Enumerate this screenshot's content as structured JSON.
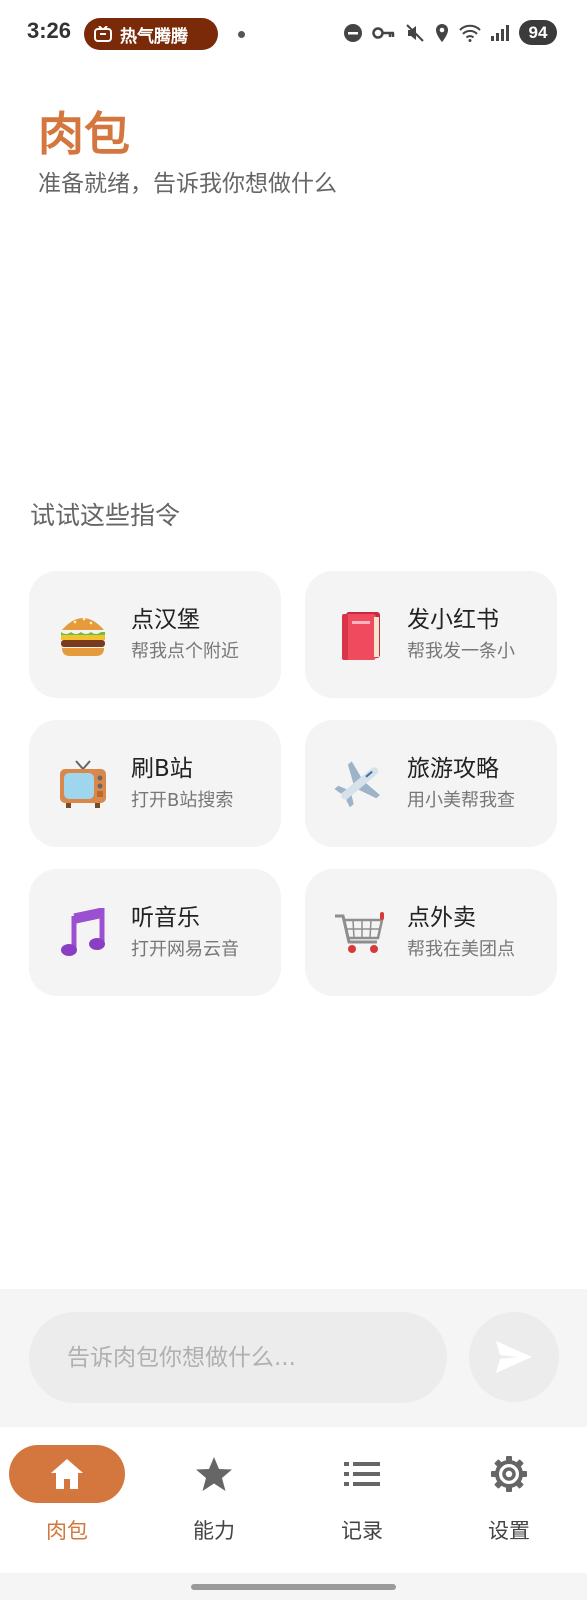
{
  "status_bar": {
    "time": "3:26",
    "notification": "热气腾腾",
    "battery": "94"
  },
  "header": {
    "title": "肉包",
    "subtitle": "准备就绪，告诉我你想做什么"
  },
  "suggestions": {
    "section_title": "试试这些指令",
    "items": [
      {
        "icon": "hamburger-icon",
        "title": "点汉堡",
        "desc": "帮我点个附近"
      },
      {
        "icon": "red-book-icon",
        "title": "发小红书",
        "desc": "帮我发一条小"
      },
      {
        "icon": "tv-icon",
        "title": "刷B站",
        "desc": "打开B站搜索"
      },
      {
        "icon": "airplane-icon",
        "title": "旅游攻略",
        "desc": "用小美帮我查"
      },
      {
        "icon": "music-note-icon",
        "title": "听音乐",
        "desc": "打开网易云音"
      },
      {
        "icon": "shopping-cart-icon",
        "title": "点外卖",
        "desc": "帮我在美团点"
      }
    ]
  },
  "input": {
    "placeholder": "告诉肉包你想做什么...",
    "value": ""
  },
  "nav": {
    "items": [
      {
        "label": "肉包",
        "icon": "home-icon",
        "active": true
      },
      {
        "label": "能力",
        "icon": "star-icon",
        "active": false
      },
      {
        "label": "记录",
        "icon": "list-icon",
        "active": false
      },
      {
        "label": "设置",
        "icon": "gear-icon",
        "active": false
      }
    ]
  },
  "colors": {
    "accent": "#d4773f",
    "card_bg": "#f4f4f4",
    "notification_pill": "#7a2a08"
  }
}
